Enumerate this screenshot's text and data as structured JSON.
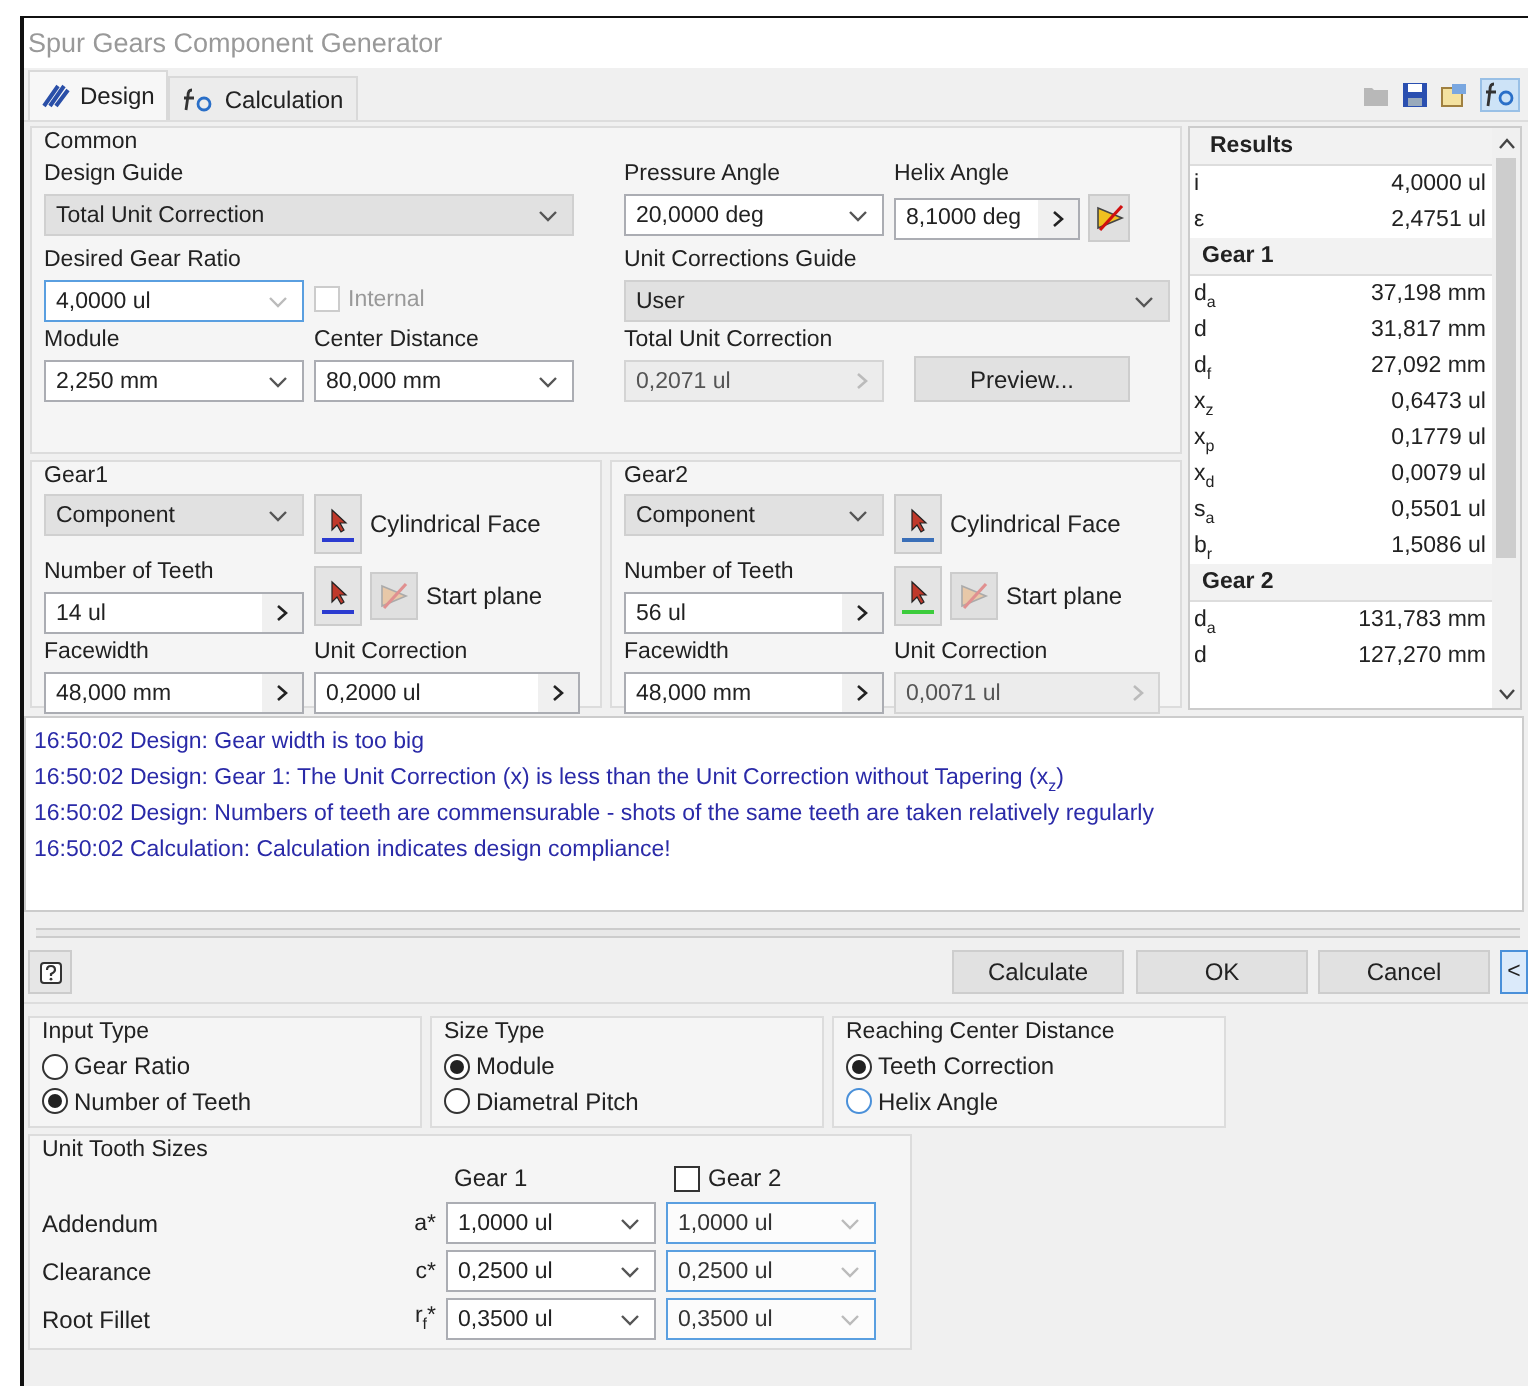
{
  "window": {
    "title": "Spur Gears Component Generator"
  },
  "tabs": [
    {
      "label": "Design",
      "selected": true
    },
    {
      "label": "Calculation",
      "selected": false
    }
  ],
  "common": {
    "title": "Common",
    "design_guide": {
      "label": "Design Guide",
      "value": "Total Unit Correction",
      "kind": "list",
      "disabled": false,
      "focused": false
    },
    "pressure_angle": {
      "label": "Pressure Angle",
      "value": "20,0000 deg",
      "kind": "dropdown",
      "disabled": false,
      "focused": false
    },
    "helix_angle": {
      "label": "Helix Angle",
      "value": "8,1000 deg",
      "kind": "spin",
      "disabled": false,
      "focused": false
    },
    "desired_gear_ratio": {
      "label": "Desired Gear Ratio",
      "value": "4,0000 ul",
      "kind": "dropdown",
      "disabled": false,
      "focused": true
    },
    "internal": {
      "label": "Internal",
      "checked": false,
      "disabled": true
    },
    "unit_corrections_guide": {
      "label": "Unit Corrections Guide",
      "value": "User",
      "kind": "list",
      "disabled": false,
      "focused": false
    },
    "module": {
      "label": "Module",
      "value": "2,250 mm",
      "kind": "dropdown",
      "disabled": false,
      "focused": false
    },
    "center_distance": {
      "label": "Center Distance",
      "value": "80,000 mm",
      "kind": "dropdown",
      "disabled": false,
      "focused": false
    },
    "total_unit_correction": {
      "label": "Total Unit Correction",
      "value": "0,2071 ul",
      "kind": "spin",
      "disabled": true,
      "focused": false
    },
    "preview_button": "Preview..."
  },
  "gears": [
    {
      "title": "Gear1",
      "component": {
        "value": "Component",
        "kind": "list",
        "disabled": false,
        "focused": false
      },
      "cylindrical_face": "Cylindrical Face",
      "start_plane": "Start plane",
      "number_of_teeth": {
        "label": "Number of Teeth",
        "value": "14 ul",
        "kind": "spin",
        "disabled": false,
        "focused": false
      },
      "facewidth": {
        "label": "Facewidth",
        "value": "48,000 mm",
        "kind": "spin",
        "disabled": false,
        "focused": false
      },
      "unit_correction": {
        "label": "Unit Correction",
        "value": "0,2000 ul",
        "kind": "spin",
        "disabled": false,
        "focused": false
      }
    },
    {
      "title": "Gear2",
      "component": {
        "value": "Component",
        "kind": "list",
        "disabled": false,
        "focused": false
      },
      "cylindrical_face": "Cylindrical Face",
      "start_plane": "Start plane",
      "number_of_teeth": {
        "label": "Number of Teeth",
        "value": "56 ul",
        "kind": "spin",
        "disabled": false,
        "focused": false
      },
      "facewidth": {
        "label": "Facewidth",
        "value": "48,000 mm",
        "kind": "spin",
        "disabled": false,
        "focused": false
      },
      "unit_correction": {
        "label": "Unit Correction",
        "value": "0,0071 ul",
        "kind": "spin",
        "disabled": true,
        "focused": false
      }
    }
  ],
  "results": {
    "title": "Results",
    "sections": [
      {
        "rows": [
          {
            "symbol": "i",
            "value": "4,0000 ul"
          },
          {
            "symbol": "ε",
            "value": "2,4751 ul"
          }
        ]
      },
      {
        "title": "Gear 1",
        "rows": [
          {
            "symbol": "d$_{a}$",
            "value": "37,198 mm"
          },
          {
            "symbol": "d",
            "value": "31,817 mm"
          },
          {
            "symbol": "d$_{f}$",
            "value": "27,092 mm"
          },
          {
            "symbol": "x$_{z}$",
            "value": "0,6473 ul"
          },
          {
            "symbol": "x$_{p}$",
            "value": "0,1779 ul"
          },
          {
            "symbol": "x$_{d}$",
            "value": "0,0079 ul"
          },
          {
            "symbol": "s$_{a}$",
            "value": "0,5501 ul"
          },
          {
            "symbol": "b$_{r}$",
            "value": "1,5086 ul"
          }
        ]
      },
      {
        "title": "Gear 2",
        "rows": [
          {
            "symbol": "d$_{a}$",
            "value": "131,783 mm"
          },
          {
            "symbol": "d",
            "value": "127,270 mm"
          }
        ]
      }
    ]
  },
  "log": [
    "16:50:02 Design: Gear width is too big",
    "16:50:02 Design: Gear 1: The Unit Correction (x) is less than the Unit Correction without Tapering (x$_{z}$)",
    "16:50:02 Design: Numbers of teeth are commensurable - shots of the same teeth are taken relatively regularly",
    "16:50:02 Calculation: Calculation indicates design compliance!"
  ],
  "buttons": [
    "Calculate",
    "OK",
    "Cancel"
  ],
  "collapse_button": "<",
  "option_groups": [
    {
      "title": "Input Type",
      "options": [
        {
          "label": "Gear Ratio",
          "selected": false
        },
        {
          "label": "Number of Teeth",
          "selected": true
        }
      ]
    },
    {
      "title": "Size Type",
      "options": [
        {
          "label": "Module",
          "selected": true
        },
        {
          "label": "Diametral Pitch",
          "selected": false
        }
      ]
    },
    {
      "title": "Reaching Center Distance",
      "options": [
        {
          "label": "Teeth Correction",
          "selected": true
        },
        {
          "label": "Helix Angle",
          "selected": false
        }
      ]
    }
  ],
  "unit_tooth_sizes": {
    "title": "Unit Tooth Sizes",
    "gear1_header": "Gear 1",
    "gear2": {
      "label": "Gear 2",
      "checked": false
    },
    "rows": [
      {
        "label": "Addendum",
        "symbol": "a*",
        "gear1": {
          "value": "1,0000 ul",
          "kind": "dropdown",
          "disabled": false,
          "focused": false
        },
        "gear2": {
          "value": "1,0000 ul",
          "kind": "dropdown",
          "disabled": true,
          "focused": true
        }
      },
      {
        "label": "Clearance",
        "symbol": "c*",
        "gear1": {
          "value": "0,2500 ul",
          "kind": "dropdown",
          "disabled": false,
          "focused": false
        },
        "gear2": {
          "value": "0,2500 ul",
          "kind": "dropdown",
          "disabled": true,
          "focused": true
        }
      },
      {
        "label": "Root Fillet",
        "symbol": "r$_{f}$*",
        "gear1": {
          "value": "0,3500 ul",
          "kind": "dropdown",
          "disabled": false,
          "focused": false
        },
        "gear2": {
          "value": "0,3500 ul",
          "kind": "dropdown",
          "disabled": true,
          "focused": true
        }
      }
    ]
  }
}
